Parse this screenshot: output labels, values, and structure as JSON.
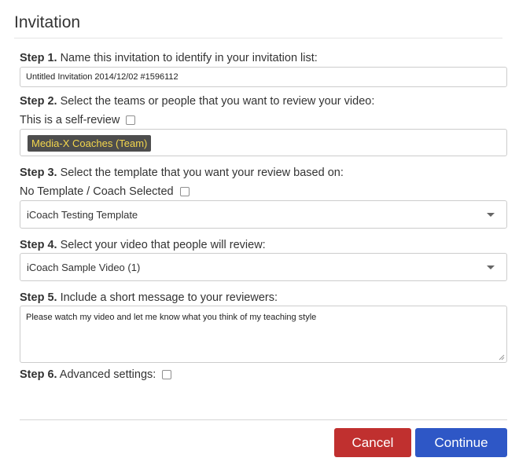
{
  "header": {
    "title": "Invitation"
  },
  "step1": {
    "label_strong": "Step 1.",
    "label_text": " Name this invitation to identify in your invitation list:",
    "value": "Untitled Invitation 2014/12/02 #1596112"
  },
  "step2": {
    "label_strong": "Step 2.",
    "label_text": " Select the teams or people that you want to review your video:",
    "self_review_label": "This is a self-review",
    "selected_tag": "Media-X Coaches (Team)"
  },
  "step3": {
    "label_strong": "Step 3.",
    "label_text": " Select the template that you want your review based on:",
    "no_template_label": "No Template / Coach Selected",
    "selected_template": "iCoach Testing Template"
  },
  "step4": {
    "label_strong": "Step 4.",
    "label_text": " Select your video that people will review:",
    "selected_video": "iCoach Sample Video (1)"
  },
  "step5": {
    "label_strong": "Step 5.",
    "label_text": " Include a short message to your reviewers:",
    "message": "Please watch my video and let me know what you think of my teaching style"
  },
  "step6": {
    "label_strong": "Step 6.",
    "label_text": " Advanced settings:"
  },
  "buttons": {
    "cancel": "Cancel",
    "continue": "Continue"
  },
  "colors": {
    "cancel_bg": "#c0302f",
    "continue_bg": "#2e57c6",
    "tag_bg": "#4d4d4d",
    "tag_text": "#f3d64d"
  }
}
